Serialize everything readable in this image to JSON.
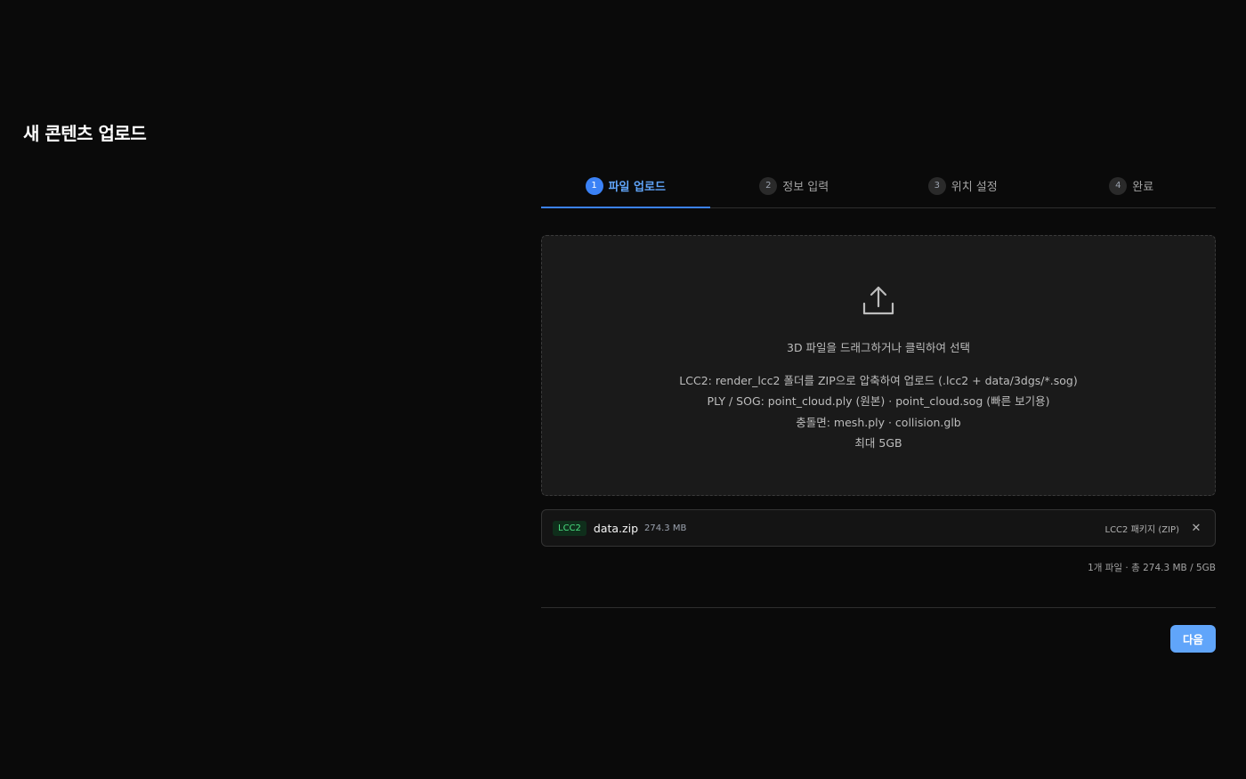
{
  "page": {
    "title": "새 콘텐츠 업로드"
  },
  "steps": [
    {
      "num": "1",
      "label": "파일 업로드",
      "active": true
    },
    {
      "num": "2",
      "label": "정보 입력",
      "active": false
    },
    {
      "num": "3",
      "label": "위치 설정",
      "active": false
    },
    {
      "num": "4",
      "label": "완료",
      "active": false
    }
  ],
  "dropzone": {
    "icon": "upload-icon",
    "primary": "3D 파일을 드래그하거나 클릭하여 선택",
    "lines": [
      "LCC2: render_lcc2 폴더를 ZIP으로 압축하여 업로드 (.lcc2 + data/3dgs/*.sog)",
      "PLY / SOG: point_cloud.ply (원본) · point_cloud.sog (빠른 보기용)",
      "충돌면: mesh.ply · collision.glb",
      "최대 5GB"
    ]
  },
  "file": {
    "badge": "LCC2",
    "name": "data.zip",
    "size": "274.3 MB",
    "type": "LCC2 패키지 (ZIP)",
    "remove_icon": "close-icon",
    "remove_glyph": "✕"
  },
  "summary": "1개 파일 · 총 274.3 MB / 5GB",
  "footer": {
    "next_label": "다음"
  },
  "colors": {
    "background": "#0a0a0a",
    "accent": "#3b82f6",
    "button": "#60a5fa",
    "badge_text": "#4ade80"
  }
}
